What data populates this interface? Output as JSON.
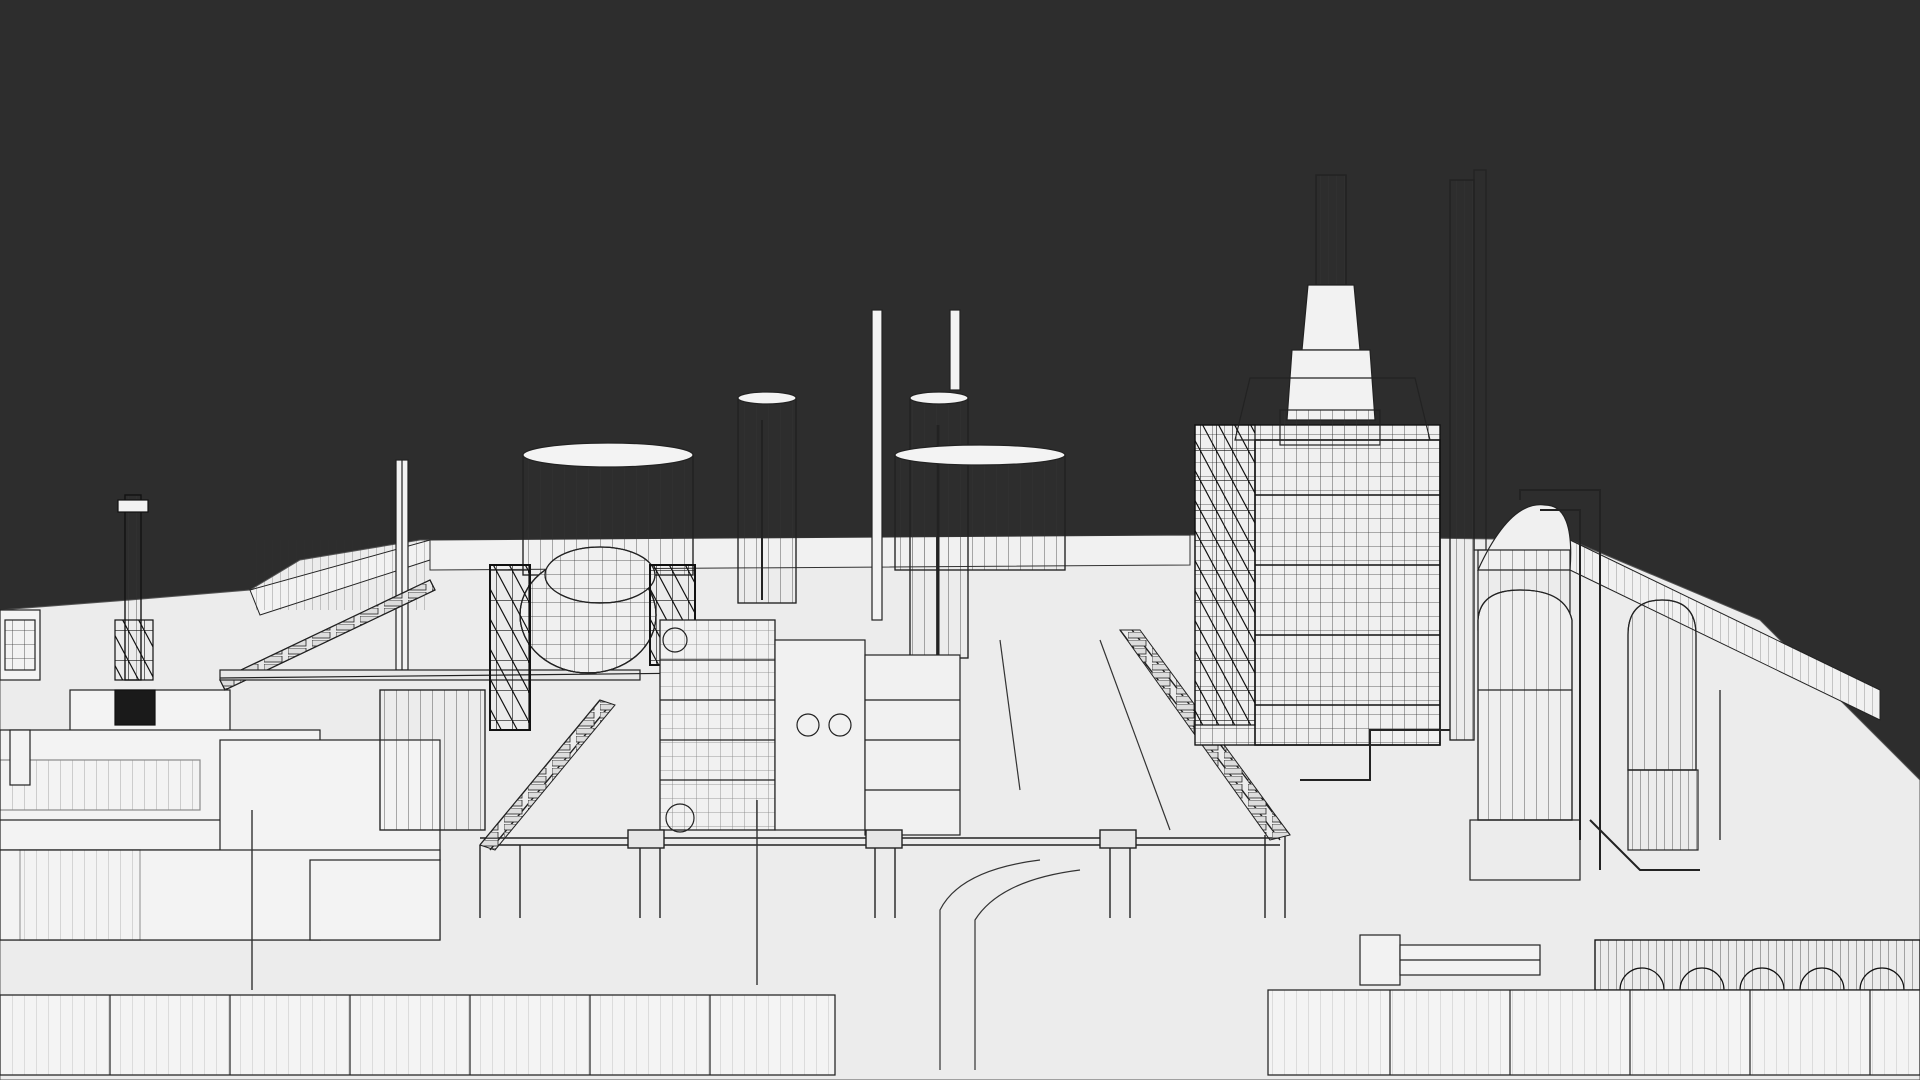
{
  "scene": {
    "subject": "wireframe-render-industrial-refinery",
    "colors": {
      "background": "#2d2d2d",
      "ground": "#ececec",
      "surface": "#f3f3f3",
      "surface_shade": "#e2e2e2",
      "line": "#1e1e1e",
      "line_light": "#6a6a6a"
    }
  }
}
